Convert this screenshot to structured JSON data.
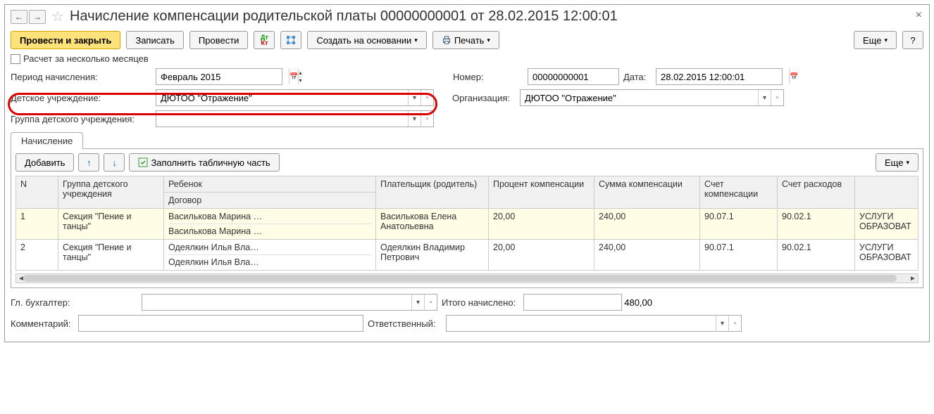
{
  "title": "Начисление компенсации родительской платы 00000000001 от 28.02.2015 12:00:01",
  "toolbar": {
    "post_close": "Провести и закрыть",
    "save": "Записать",
    "post": "Провести",
    "create_based": "Создать на основании",
    "print": "Печать",
    "more": "Еще"
  },
  "checkbox_multi": "Расчет за несколько месяцев",
  "labels": {
    "period": "Период начисления:",
    "number": "Номер:",
    "date": "Дата:",
    "institution": "Детское учреждение:",
    "organization": "Организация:",
    "group": "Группа детского учреждения:",
    "accountant": "Гл. бухгалтер:",
    "total": "Итого начислено:",
    "comment": "Комментарий:",
    "responsible": "Ответственный:"
  },
  "fields": {
    "period": "Февраль 2015",
    "number": "00000000001",
    "date": "28.02.2015 12:00:01",
    "institution": "ДЮТОО \"Отражение\"",
    "organization": "ДЮТОО \"Отражение\"",
    "group": "",
    "accountant": "",
    "total": "480,00",
    "comment": "",
    "responsible": ""
  },
  "tab": "Начисление",
  "tab_toolbar": {
    "add": "Добавить",
    "fill": "Заполнить табличную часть",
    "more": "Еще"
  },
  "columns": {
    "n": "N",
    "group": "Группа детского учреждения",
    "child": "Ребенок",
    "contract": "Договор",
    "payer": "Плательщик (родитель)",
    "percent": "Процент компенсации",
    "sum": "Сумма компенсации",
    "acc_comp": "Счет компенсации",
    "acc_exp": "Счет расходов",
    "extra": ""
  },
  "rows": [
    {
      "n": "1",
      "group": "Секция \"Пение и танцы\"",
      "child": "Василькова Марина …",
      "contract": "Василькова Марина …",
      "payer": "Василькова Елена Анатольевна",
      "percent": "20,00",
      "sum": "240,00",
      "acc_comp": "90.07.1",
      "acc_exp": "90.02.1",
      "extra": "УСЛУГИ ОБРАЗОВАТ"
    },
    {
      "n": "2",
      "group": "Секция \"Пение и танцы\"",
      "child": "Одеялкин Илья Вла…",
      "contract": "Одеялкин Илья Вла…",
      "payer": "Одеялкин Владимир Петрович",
      "percent": "20,00",
      "sum": "240,00",
      "acc_comp": "90.07.1",
      "acc_exp": "90.02.1",
      "extra": "УСЛУГИ ОБРАЗОВАТ"
    }
  ]
}
